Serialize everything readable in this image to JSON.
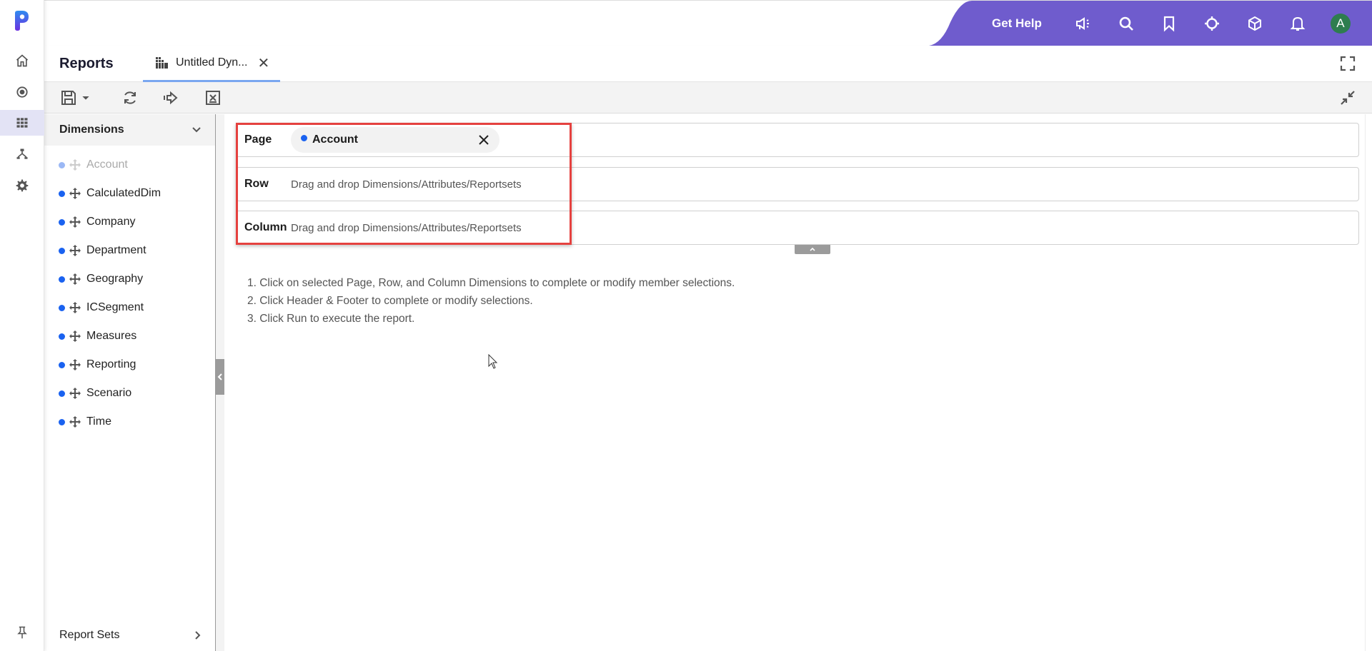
{
  "rail": {
    "logo": "app-logo",
    "items": [
      {
        "name": "home",
        "icon": "home-icon"
      },
      {
        "name": "target",
        "icon": "circle-dot-icon"
      },
      {
        "name": "reports",
        "icon": "grid-icon",
        "active": true
      },
      {
        "name": "hierarchy",
        "icon": "hierarchy-icon"
      },
      {
        "name": "settings",
        "icon": "gear-icon"
      }
    ],
    "pin_icon": "pin-icon"
  },
  "header": {
    "get_help": "Get Help",
    "icons": [
      "megaphone-icon",
      "search-icon",
      "bookmark-icon",
      "crosshair-icon",
      "cube-icon",
      "bell-icon"
    ],
    "avatar_initial": "A",
    "brand_color": "#6f5ccd",
    "avatar_color": "#2e7d4f"
  },
  "titlebar": {
    "title": "Reports",
    "tab_label": "Untitled Dyn...",
    "tab_close": "✕"
  },
  "toolbar": {
    "buttons": [
      "save",
      "refresh",
      "run",
      "clear-format"
    ]
  },
  "dimensions": {
    "header": "Dimensions",
    "items": [
      {
        "label": "Account",
        "disabled": true
      },
      {
        "label": "CalculatedDim"
      },
      {
        "label": "Company"
      },
      {
        "label": "Department"
      },
      {
        "label": "Geography"
      },
      {
        "label": "ICSegment"
      },
      {
        "label": "Measures"
      },
      {
        "label": "Reporting"
      },
      {
        "label": "Scenario"
      },
      {
        "label": "Time"
      }
    ],
    "footer": "Report Sets"
  },
  "layout": {
    "page_label": "Page",
    "page_chip": "Account",
    "row_label": "Row",
    "row_hint": "Drag and drop Dimensions/Attributes/Reportsets",
    "column_label": "Column",
    "column_hint": "Drag and drop Dimensions/Attributes/Reportsets",
    "highlight_color": "#e5413f"
  },
  "instructions": [
    "1. Click on selected Page, Row, and Column Dimensions to complete or modify member selections.",
    "2. Click Header & Footer to complete or modify selections.",
    "3. Click Run to execute the report."
  ]
}
